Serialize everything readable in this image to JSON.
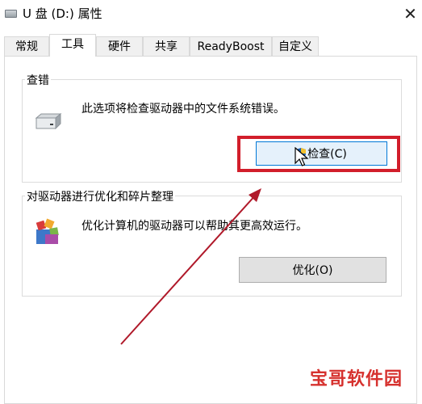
{
  "window": {
    "title": "U 盘 (D:) 属性",
    "close_glyph": "✕"
  },
  "tabs": [
    {
      "label": "常规"
    },
    {
      "label": "工具"
    },
    {
      "label": "硬件"
    },
    {
      "label": "共享"
    },
    {
      "label": "ReadyBoost"
    },
    {
      "label": "自定义"
    }
  ],
  "active_tab": "工具",
  "error_check": {
    "title": "查错",
    "description": "此选项将检查驱动器中的文件系统错误。",
    "button_label": "检查(C)",
    "icon": "drive-icon"
  },
  "optimize": {
    "title": "对驱动器进行优化和碎片整理",
    "description": "优化计算机的驱动器可以帮助其更高效运行。",
    "button_label": "优化(O)",
    "icon": "defrag-icon"
  },
  "annotation": {
    "highlight_color": "#d21e2b",
    "arrow_color": "#b0192a"
  },
  "watermark": {
    "text": "宝哥软件园",
    "color": "#d6312e"
  }
}
